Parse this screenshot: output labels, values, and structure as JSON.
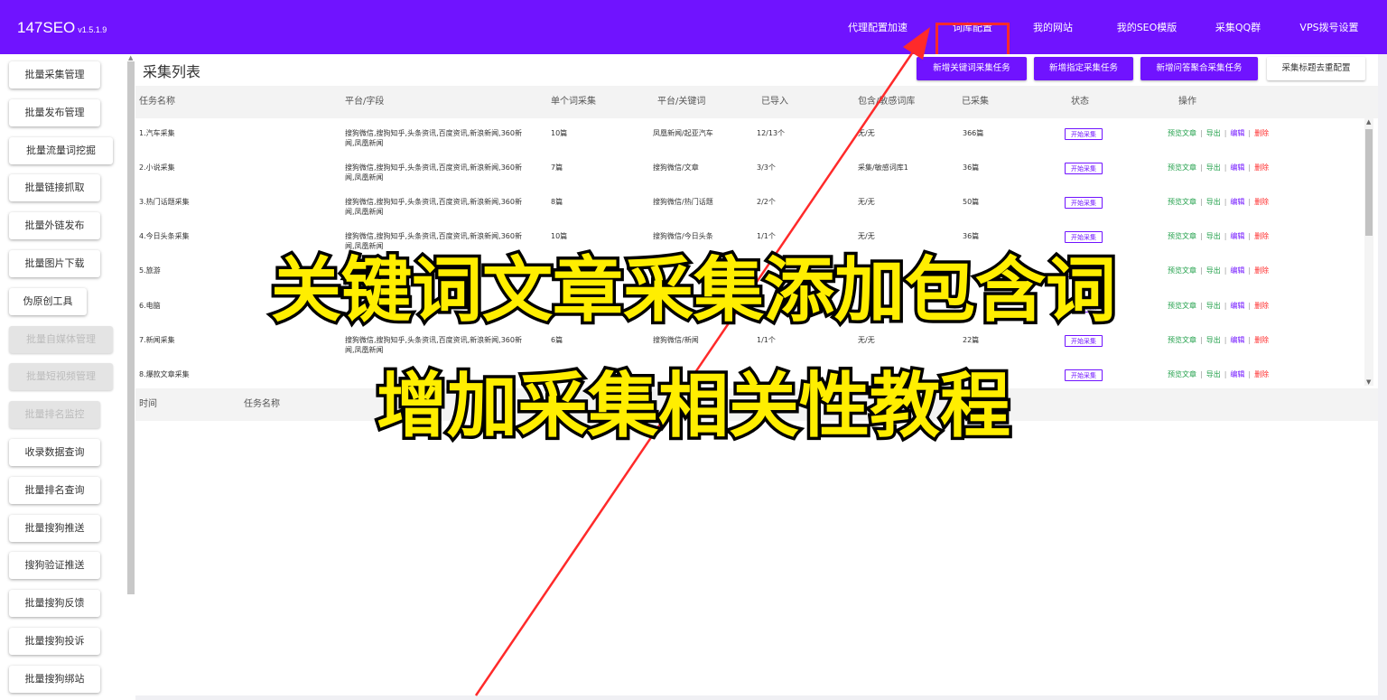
{
  "app": {
    "brand": "147SEO",
    "version": "v1.5.1.9"
  },
  "topnav": [
    {
      "label": "代理配置加速",
      "name": "topnav-proxy"
    },
    {
      "label": "词库配置",
      "name": "topnav-lexicon"
    },
    {
      "label": "我的网站",
      "name": "topnav-my-sites"
    },
    {
      "label": "我的SEO模版",
      "name": "topnav-seo-templates"
    },
    {
      "label": "采集QQ群",
      "name": "topnav-qq-group"
    },
    {
      "label": "VPS拨号设置",
      "name": "topnav-vps-dial"
    }
  ],
  "sidebar": [
    {
      "label": "批量采集管理",
      "disabled": false
    },
    {
      "label": "批量发布管理",
      "disabled": false
    },
    {
      "label": "批量流量词挖掘",
      "disabled": false
    },
    {
      "label": "批量链接抓取",
      "disabled": false
    },
    {
      "label": "批量外链发布",
      "disabled": false
    },
    {
      "label": "批量图片下载",
      "disabled": false
    },
    {
      "label": "伪原创工具",
      "disabled": false
    },
    {
      "label": "批量自媒体管理",
      "disabled": true
    },
    {
      "label": "批量短视频管理",
      "disabled": true
    },
    {
      "label": "批量排名监控",
      "disabled": true
    },
    {
      "label": "收录数据查询",
      "disabled": false
    },
    {
      "label": "批量排名查询",
      "disabled": false
    },
    {
      "label": "批量搜狗推送",
      "disabled": false
    },
    {
      "label": "搜狗验证推送",
      "disabled": false
    },
    {
      "label": "批量搜狗反馈",
      "disabled": false
    },
    {
      "label": "批量搜狗投诉",
      "disabled": false
    },
    {
      "label": "批量搜狗绑站",
      "disabled": false
    }
  ],
  "main": {
    "title": "采集列表",
    "actions": [
      {
        "label": "新增关键词采集任务",
        "style": "primary"
      },
      {
        "label": "新增指定采集任务",
        "style": "primary"
      },
      {
        "label": "新增问答聚合采集任务",
        "style": "primary"
      },
      {
        "label": "采集标题去重配置",
        "style": "light"
      }
    ],
    "columns": [
      "任务名称",
      "平台/字段",
      "单个词采集",
      "平台/关键词",
      "已导入",
      "包含/敏感词库",
      "已采集",
      "状态",
      "操作"
    ],
    "status_label": "开始采集",
    "ops": {
      "preview": "预览文章",
      "export": "导出",
      "edit": "编辑",
      "delete": "删除",
      "sep": "|"
    },
    "rows": [
      {
        "name": "1.汽车采集",
        "platform": "搜狗微信,搜狗知乎,头条资讯,百度资讯,新浪新闻,360新闻,凤凰新闻",
        "per_word": "10篇",
        "kw": "凤凰新闻/起亚汽车",
        "imported": "12/13个",
        "lexicon": "无/无",
        "collected": "366篇"
      },
      {
        "name": "2.小说采集",
        "platform": "搜狗微信,搜狗知乎,头条资讯,百度资讯,新浪新闻,360新闻,凤凰新闻",
        "per_word": "7篇",
        "kw": "搜狗微信/文章",
        "imported": "3/3个",
        "lexicon": "采集/敏感词库1",
        "collected": "36篇"
      },
      {
        "name": "3.热门话题采集",
        "platform": "搜狗微信,搜狗知乎,头条资讯,百度资讯,新浪新闻,360新闻,凤凰新闻",
        "per_word": "8篇",
        "kw": "搜狗微信/热门话题",
        "imported": "2/2个",
        "lexicon": "无/无",
        "collected": "50篇"
      },
      {
        "name": "4.今日头条采集",
        "platform": "搜狗微信,搜狗知乎,头条资讯,百度资讯,新浪新闻,360新闻,凤凰新闻",
        "per_word": "10篇",
        "kw": "搜狗微信/今日头条",
        "imported": "1/1个",
        "lexicon": "无/无",
        "collected": "36篇"
      },
      {
        "name": "5.旅游",
        "platform": "",
        "per_word": "",
        "kw": "",
        "imported": "",
        "lexicon": "",
        "collected": ""
      },
      {
        "name": "6.电脑",
        "platform": "",
        "per_word": "",
        "kw": "",
        "imported": "",
        "lexicon": "",
        "collected": ""
      },
      {
        "name": "7.新闻采集",
        "platform": "搜狗微信,搜狗知乎,头条资讯,百度资讯,新浪新闻,360新闻,凤凰新闻",
        "per_word": "6篇",
        "kw": "搜狗微信/新闻",
        "imported": "1/1个",
        "lexicon": "无/无",
        "collected": "22篇"
      },
      {
        "name": "8.爆款文章采集",
        "platform": "",
        "per_word": "",
        "kw": "",
        "imported": "",
        "lexicon": "",
        "collected": ""
      }
    ],
    "log_columns": [
      "时间",
      "任务名称"
    ]
  },
  "overlay": {
    "line1": "关键词文章采集添加包含词",
    "line2": "增加采集相关性教程",
    "color": "#ffee00",
    "arrow_color": "#ff2a2a",
    "highlight_color": "#ff2a2a"
  },
  "colors": {
    "brand": "#7013ff",
    "preview": "#22a04b",
    "delete": "#ff2d2d"
  }
}
